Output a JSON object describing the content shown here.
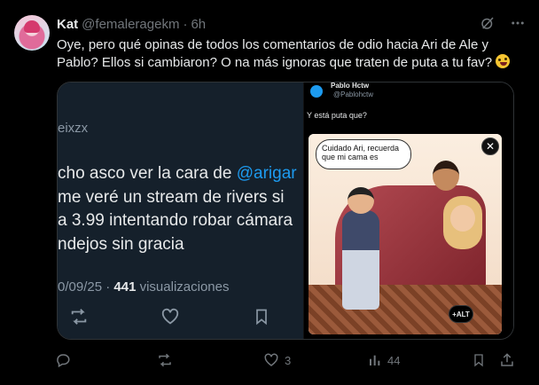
{
  "author": {
    "name": "Kat",
    "handle": "@femaleragekm",
    "separator": "·",
    "time": "6h"
  },
  "tweet": {
    "text": "Oye, pero qué opinas de todos los comentarios de odio hacia Ari de Ale y Pablo? Ellos si cambiaron? O na más ignoras que traten de puta a tu fav?"
  },
  "quoted_left": {
    "handle_fragment": "eixzx",
    "line1_prefix": "cho asco ver la cara de ",
    "line1_mention": "@arigar",
    "line2": " me veré un stream de rivers si",
    "line3": "a 3.99 intentando robar cámara",
    "line4": "ndejos sin gracia",
    "date": "0/09/25 · ",
    "views": "441",
    "views_label": " visualizaciones"
  },
  "quoted_right": {
    "name": "Pablo Hctw",
    "handle": "@Pablohctw",
    "text": "Y está puta que?",
    "bubble": "Cuidado Ari, recuerda que mi cama es",
    "close_glyph": "✕",
    "alt_label": "+ALT"
  },
  "metrics": {
    "likes": "3",
    "views": "44"
  }
}
